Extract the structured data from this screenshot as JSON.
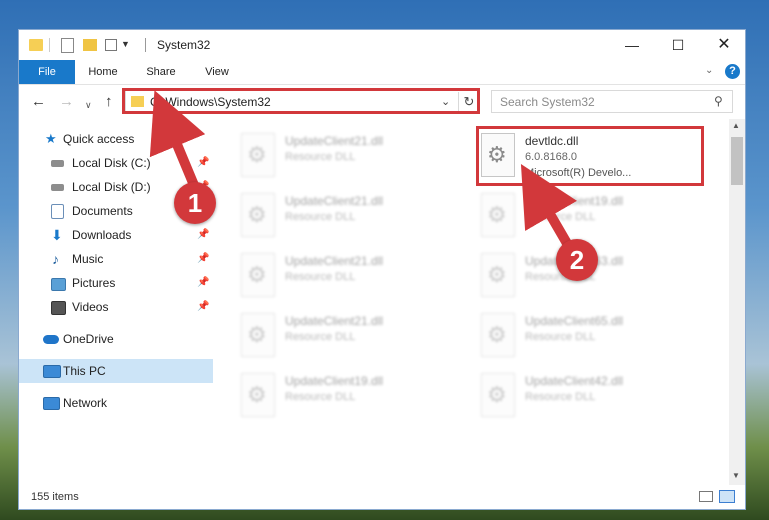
{
  "window": {
    "title": "System32",
    "controls": {
      "minimize": "—",
      "maximize": "☐",
      "close": "✕"
    }
  },
  "ribbon": {
    "tabs": [
      "File",
      "Home",
      "Share",
      "View"
    ],
    "help": "?"
  },
  "address": {
    "path": "C:\\Windows\\System32",
    "search_placeholder": "Search System32"
  },
  "sidebar": {
    "items": [
      {
        "label": "Quick access",
        "icon": "star-icon",
        "pinned": false
      },
      {
        "label": "Local Disk (C:)",
        "icon": "drive-icon",
        "pinned": true
      },
      {
        "label": "Local Disk (D:)",
        "icon": "drive-icon",
        "pinned": true
      },
      {
        "label": "Documents",
        "icon": "documents-icon",
        "pinned": true
      },
      {
        "label": "Downloads",
        "icon": "download-icon",
        "pinned": true
      },
      {
        "label": "Music",
        "icon": "music-icon",
        "pinned": true
      },
      {
        "label": "Pictures",
        "icon": "pictures-icon",
        "pinned": true
      },
      {
        "label": "Videos",
        "icon": "videos-icon",
        "pinned": true
      },
      {
        "label": "OneDrive",
        "icon": "cloud-icon",
        "pinned": false
      },
      {
        "label": "This PC",
        "icon": "computer-icon",
        "pinned": false,
        "selected": true
      },
      {
        "label": "Network",
        "icon": "network-icon",
        "pinned": false
      }
    ]
  },
  "files": [
    {
      "name": "UpdateClient21.dll",
      "type": "Resource DLL"
    },
    {
      "name": "devtldc.dll",
      "type": "6.0.8168.0",
      "description": "Microsoft(R) Develo...",
      "highlighted": true
    },
    {
      "name": "UpdateClient21.dll",
      "type": "Resource DLL"
    },
    {
      "name": "UpdateClient19.dll",
      "type": "Resource DLL"
    },
    {
      "name": "UpdateClient21.dll",
      "type": "Resource DLL"
    },
    {
      "name": "UpdateClient63.dll",
      "type": "Resource DLL"
    },
    {
      "name": "UpdateClient21.dll",
      "type": "Resource DLL"
    },
    {
      "name": "UpdateClient65.dll",
      "type": "Resource DLL"
    },
    {
      "name": "UpdateClient19.dll",
      "type": "Resource DLL"
    },
    {
      "name": "UpdateClient42.dll",
      "type": "Resource DLL"
    }
  ],
  "status": {
    "item_count": "155 items"
  },
  "annotations": {
    "marker1": "1",
    "marker2": "2"
  },
  "colors": {
    "accent": "#1979ca",
    "annotation": "#d2383b",
    "selection": "#cce4f7"
  }
}
